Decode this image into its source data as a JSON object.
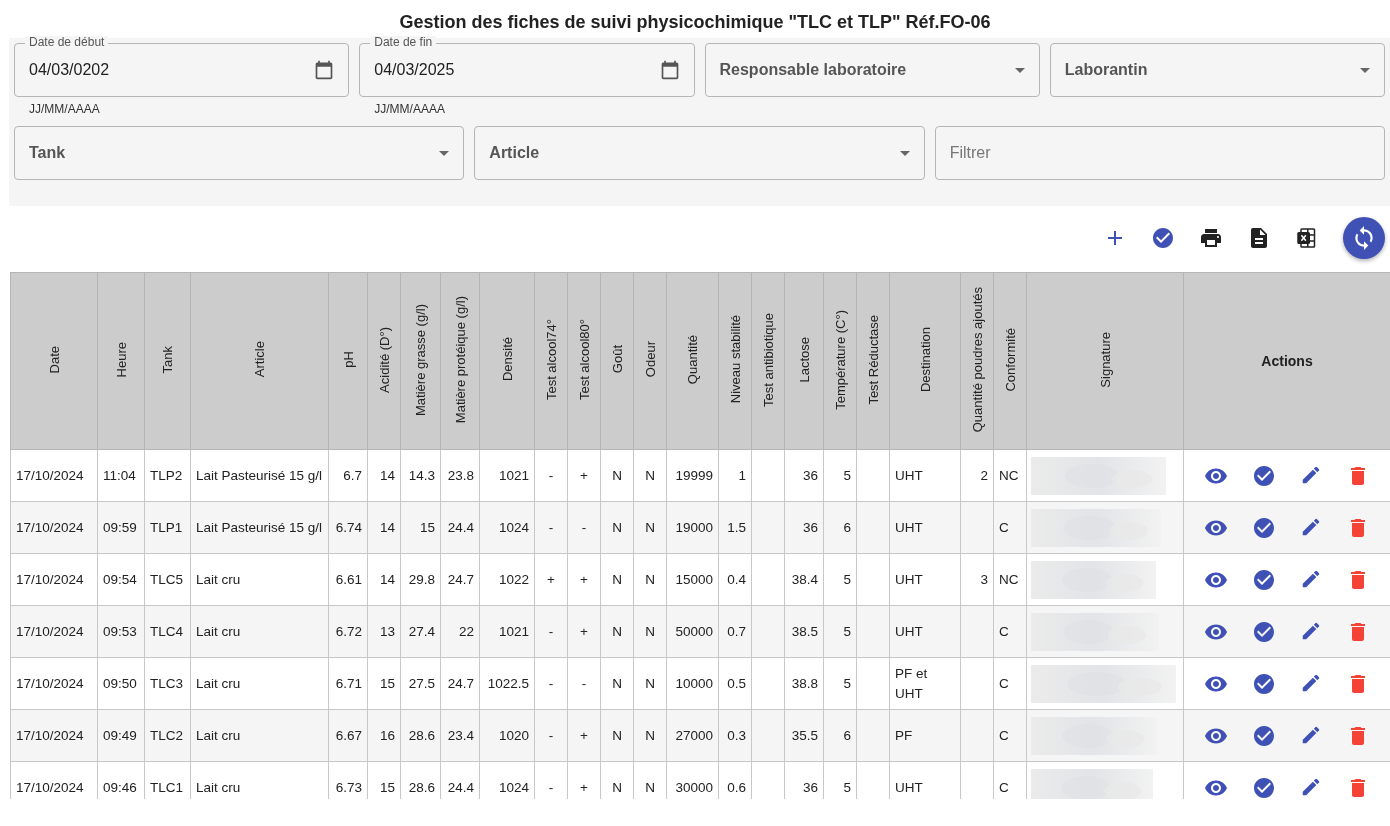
{
  "title": "Gestion des fiches de suivi physicochimique \"TLC et TLP\" Réf.FO-06",
  "date_fields": [
    {
      "label": "Date de début",
      "value": "04/03/0202",
      "helper": "JJ/MM/AAAA"
    },
    {
      "label": "Date de fin",
      "value": "04/03/2025",
      "helper": "JJ/MM/AAAA"
    }
  ],
  "selects_top": [
    {
      "label": "Responsable laboratoire"
    },
    {
      "label": "Laborantin"
    }
  ],
  "selects_bottom": [
    {
      "label": "Tank"
    },
    {
      "label": "Article"
    }
  ],
  "filter": {
    "placeholder": "Filtrer"
  },
  "table": {
    "columns": [
      "Date",
      "Heure",
      "Tank",
      "Article",
      "pH",
      "Acidité (D°)",
      "Matière grasse (g/l)",
      "Matière protéique (g/l)",
      "Densité",
      "Test alcool74°",
      "Test alcool80°",
      "Goût",
      "Odeur",
      "Quantité",
      "Niveau stabilité",
      "Test antibiotique",
      "Lactose",
      "Température (C°)",
      "Test Réductase",
      "Destination",
      "Quantité poudres ajoutés",
      "Conformité",
      "Signature",
      "Actions"
    ],
    "rows": [
      {
        "cells": [
          "17/10/2024",
          "11:04",
          "TLP2",
          "Lait Pasteurisé 15 g/l",
          "6.7",
          "14",
          "14.3",
          "23.8",
          "1021",
          "-",
          "+",
          "N",
          "N",
          "19999",
          "1",
          null,
          "36",
          "5",
          null,
          "UHT",
          "2",
          "NC"
        ]
      },
      {
        "cells": [
          "17/10/2024",
          "09:59",
          "TLP1",
          "Lait Pasteurisé 15 g/l",
          "6.74",
          "14",
          "15",
          "24.4",
          "1024",
          "-",
          "-",
          "N",
          "N",
          "19000",
          "1.5",
          null,
          "36",
          "6",
          null,
          "UHT",
          null,
          "C"
        ]
      },
      {
        "cells": [
          "17/10/2024",
          "09:54",
          "TLC5",
          "Lait cru",
          "6.61",
          "14",
          "29.8",
          "24.7",
          "1022",
          "+",
          "+",
          "N",
          "N",
          "15000",
          "0.4",
          null,
          "38.4",
          "5",
          null,
          "UHT",
          "3",
          "NC"
        ]
      },
      {
        "cells": [
          "17/10/2024",
          "09:53",
          "TLC4",
          "Lait cru",
          "6.72",
          "13",
          "27.4",
          "22",
          "1021",
          "-",
          "+",
          "N",
          "N",
          "50000",
          "0.7",
          null,
          "38.5",
          "5",
          null,
          "UHT",
          null,
          "C"
        ]
      },
      {
        "cells": [
          "17/10/2024",
          "09:50",
          "TLC3",
          "Lait cru",
          "6.71",
          "15",
          "27.5",
          "24.7",
          "1022.5",
          "-",
          "-",
          "N",
          "N",
          "10000",
          "0.5",
          null,
          "38.8",
          "5",
          null,
          "PF et UHT",
          null,
          "C"
        ]
      },
      {
        "cells": [
          "17/10/2024",
          "09:49",
          "TLC2",
          "Lait cru",
          "6.67",
          "16",
          "28.6",
          "23.4",
          "1020",
          "-",
          "+",
          "N",
          "N",
          "27000",
          "0.3",
          null,
          "35.5",
          "6",
          null,
          "PF",
          null,
          "C"
        ]
      },
      {
        "cells": [
          "17/10/2024",
          "09:46",
          "TLC1",
          "Lait cru",
          "6.73",
          "15",
          "28.6",
          "24.4",
          "1024",
          "-",
          "+",
          "N",
          "N",
          "30000",
          "0.6",
          null,
          "36",
          "5",
          null,
          "UHT",
          null,
          "C"
        ]
      }
    ]
  }
}
